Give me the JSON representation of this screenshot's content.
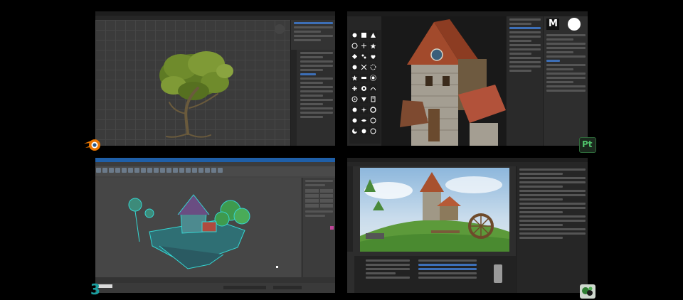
{
  "windows": {
    "blender": {
      "app": "Blender",
      "accent": "#ea7600",
      "badge_icon": "blender-logo"
    },
    "painter": {
      "app": "Substance 3D Painter",
      "badge_text": "Pt",
      "accent": "#1d9a3f",
      "brush_preview_label": "M"
    },
    "max": {
      "app": "3ds Max",
      "badge_text": "3",
      "accent": "#1a9fa0"
    },
    "marmoset": {
      "app": "Marmoset Toolbag",
      "accent": "#2e7d32",
      "badge_icon": "marmoset-logo"
    }
  },
  "colors": {
    "background": "#000000",
    "selection_blue": "#3d6fb7",
    "max_title_bar": "#1f5fa8"
  }
}
